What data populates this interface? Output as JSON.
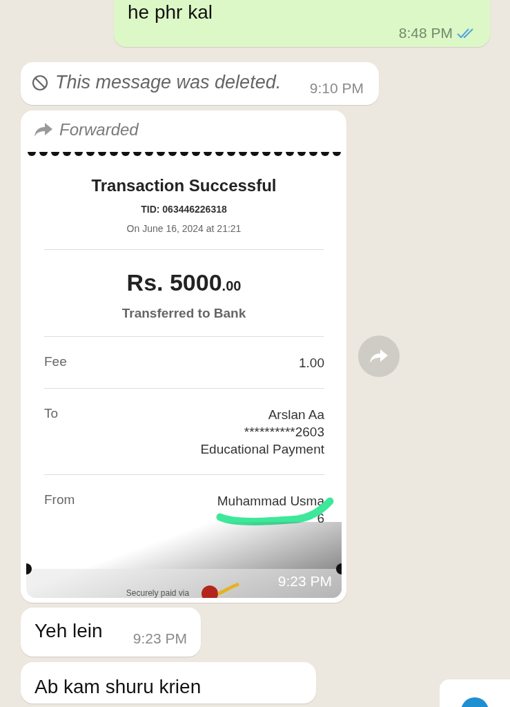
{
  "outgoing": {
    "text": "he phr kal",
    "time": "8:48 PM",
    "read": true
  },
  "deleted": {
    "text": "This message was deleted.",
    "time": "9:10 PM"
  },
  "forwarded": {
    "label": "Forwarded",
    "time": "9:23 PM",
    "receipt": {
      "title": "Transaction Successful",
      "tid": "TID: 063446226318",
      "date": "On June 16, 2024 at 21:21",
      "amount": "Rs. 5000",
      "amount_decimals": ".00",
      "subtitle": "Transferred to Bank",
      "rows": [
        {
          "label": "Fee",
          "lines": [
            "1.00"
          ]
        },
        {
          "label": "To",
          "lines": [
            "Arslan Aa",
            "**********2603",
            "Educational Payment"
          ]
        },
        {
          "label": "From",
          "lines": [
            "Muhammad Usma",
            "6"
          ],
          "redacted": true
        }
      ],
      "footer": "Securely paid via"
    }
  },
  "messages": [
    {
      "text": "Yeh lein",
      "time": "9:23 PM"
    },
    {
      "text": "Ab kam shuru krien"
    }
  ]
}
